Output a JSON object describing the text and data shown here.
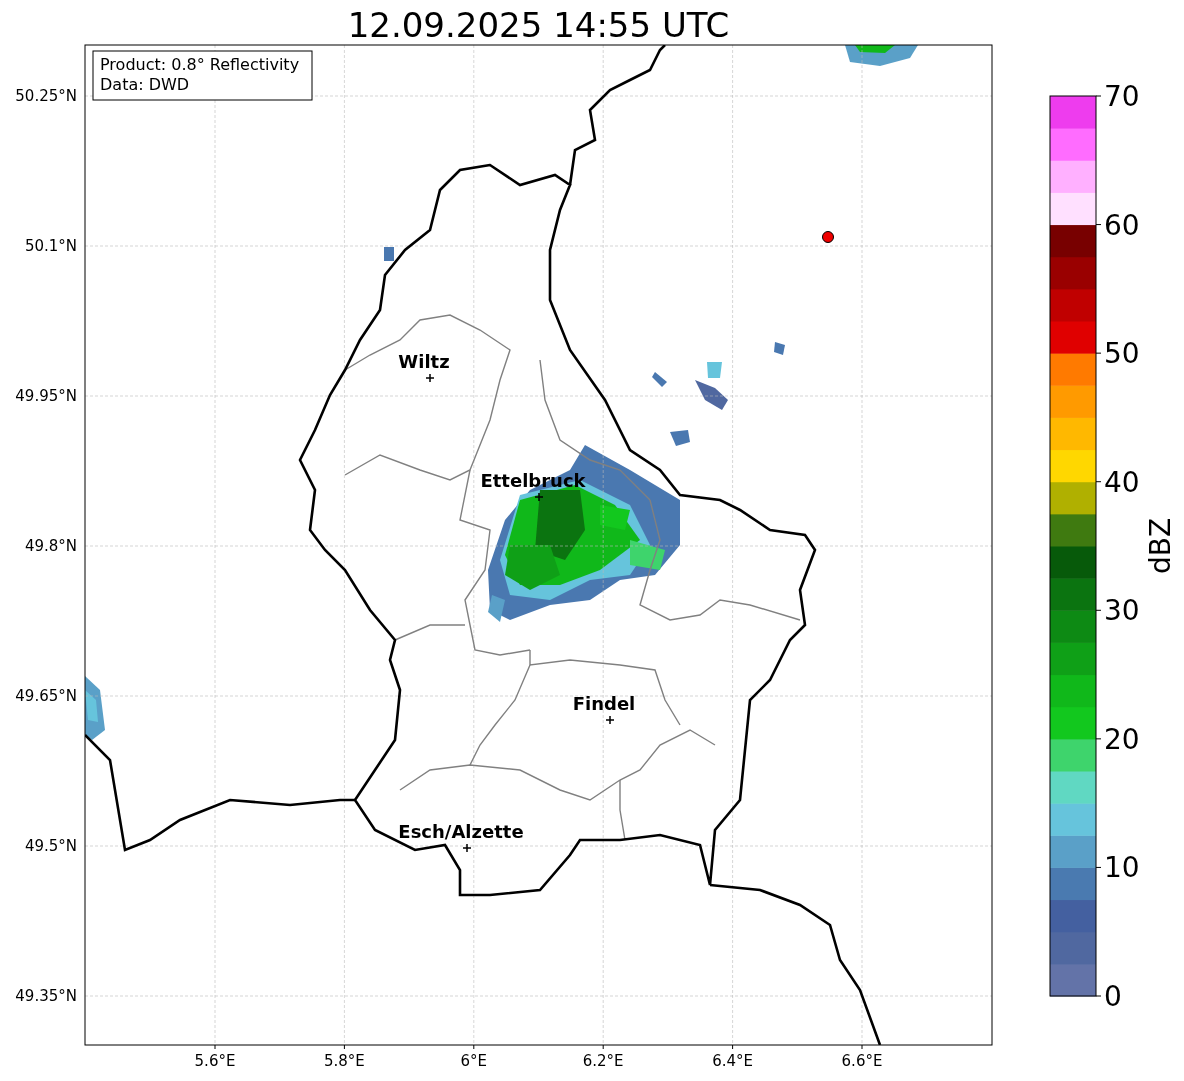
{
  "title": "12.09.2025 14:55 UTC",
  "info_box": {
    "lines": [
      "Product: 0.8° Reflectivity",
      "Data: DWD"
    ]
  },
  "x_ticks": [
    "5.6°E",
    "5.8°E",
    "6°E",
    "6.2°E",
    "6.4°E",
    "6.6°E"
  ],
  "y_ticks": [
    "50.25°N",
    "50.1°N",
    "49.95°N",
    "49.8°N",
    "49.65°N",
    "49.5°N",
    "49.35°N"
  ],
  "cities": [
    {
      "name": "Wiltz"
    },
    {
      "name": "Ettelbruck"
    },
    {
      "name": "Findel"
    },
    {
      "name": "Esch/Alzette"
    }
  ],
  "colorbar": {
    "label": "dBZ",
    "ticks": [
      "70",
      "60",
      "50",
      "40",
      "30",
      "20",
      "10",
      "0"
    ],
    "segments": [
      {
        "color": "#6373a8"
      },
      {
        "color": "#5068a0"
      },
      {
        "color": "#4460a0"
      },
      {
        "color": "#4a7ab0"
      },
      {
        "color": "#5aa0c8"
      },
      {
        "color": "#66c4dc"
      },
      {
        "color": "#60d8c2"
      },
      {
        "color": "#3ed46c"
      },
      {
        "color": "#12c81e"
      },
      {
        "color": "#10b81a"
      },
      {
        "color": "#0fa017"
      },
      {
        "color": "#0d8a14"
      },
      {
        "color": "#0b7410"
      },
      {
        "color": "#075a0a"
      },
      {
        "color": "#3f7a10"
      },
      {
        "color": "#b0b000"
      },
      {
        "color": "#ffd700"
      },
      {
        "color": "#ffb800"
      },
      {
        "color": "#ff9a00"
      },
      {
        "color": "#ff7a00"
      },
      {
        "color": "#e00000"
      },
      {
        "color": "#c00000"
      },
      {
        "color": "#9a0000"
      },
      {
        "color": "#780000"
      },
      {
        "color": "#ffe0ff"
      },
      {
        "color": "#ffb0ff"
      },
      {
        "color": "#ff6cff"
      },
      {
        "color": "#ee3cee"
      }
    ]
  }
}
